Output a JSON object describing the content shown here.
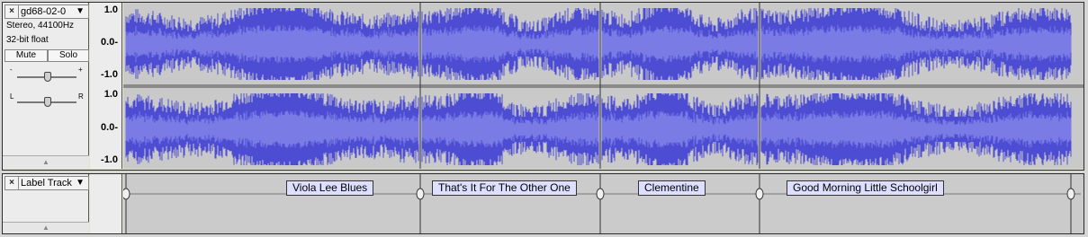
{
  "audio_track": {
    "name": "gd68-02-0",
    "format_line": "Stereo, 44100Hz",
    "bitdepth_line": "32-bit float",
    "mute_label": "Mute",
    "solo_label": "Solo",
    "gain_minus": "-",
    "gain_plus": "+",
    "pan_left": "L",
    "pan_right": "R",
    "close_glyph": "×",
    "menu_arrow": "▼",
    "collapse_glyph": "▲",
    "ruler_top": [
      "1.0",
      "0.0-",
      "-1.0"
    ],
    "ruler_bottom": [
      "1.0",
      "0.0-",
      "-1.0"
    ],
    "colors": {
      "waveform": "#4d4dd4",
      "waveform_rms": "#7b7be6",
      "background": "#c9c9c9",
      "selected_border": "#e4e4c8"
    }
  },
  "label_track": {
    "name": "Label Track",
    "close_glyph": "×",
    "menu_arrow": "▼",
    "collapse_glyph": "▲",
    "labels": [
      {
        "text": "Viola Lee Blues"
      },
      {
        "text": "That's It For The Other One"
      },
      {
        "text": "Clementine"
      },
      {
        "text": "Good Morning Little Schoolgirl"
      }
    ]
  }
}
